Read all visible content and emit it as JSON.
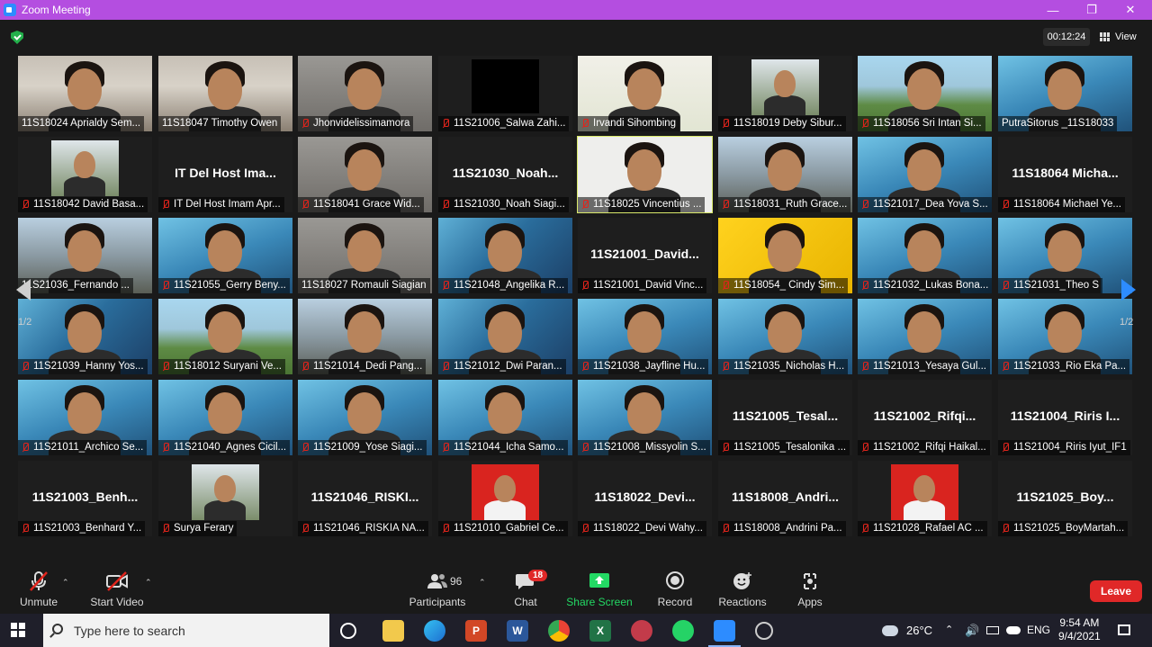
{
  "window": {
    "title": "Zoom Meeting"
  },
  "meeting": {
    "timer": "00:12:24",
    "view_label": "View"
  },
  "pager": {
    "left": "1/2",
    "right": "1/2"
  },
  "tiles": [
    {
      "label": "11S18024 Aprialdy Sem...",
      "muted": false,
      "kind": "video",
      "bg": "v-room"
    },
    {
      "label": "11S18047 Timothy Owen",
      "muted": false,
      "kind": "video",
      "bg": "v-room"
    },
    {
      "label": "Jhonvidelissimamora",
      "muted": true,
      "kind": "video",
      "bg": "v-grey"
    },
    {
      "label": "11S21006_Salwa Zahi...",
      "muted": true,
      "kind": "black",
      "bg": "v-dark"
    },
    {
      "label": "Irvandi Sihombing",
      "muted": true,
      "kind": "video",
      "bg": "v-sign"
    },
    {
      "label": "11S18019 Deby Sibur...",
      "muted": true,
      "kind": "photo",
      "bg": "v-dark"
    },
    {
      "label": "11S18056 Sri Intan Si...",
      "muted": true,
      "kind": "video",
      "bg": "v-grass"
    },
    {
      "label": "PutraSitorus _11S18033",
      "muted": false,
      "kind": "video",
      "bg": "v-bluehouse"
    },
    {
      "label": "11S18042 David Basa...",
      "muted": true,
      "kind": "photo",
      "bg": "v-dark"
    },
    {
      "label": "IT Del Host Imam Apr...",
      "muted": true,
      "kind": "name",
      "name": "IT Del Host Ima...",
      "bg": "v-dark"
    },
    {
      "label": "11S18041 Grace Wid...",
      "muted": true,
      "kind": "video",
      "bg": "v-grey"
    },
    {
      "label": "11S21030_Noah Siagi...",
      "muted": true,
      "kind": "name",
      "name": "11S21030_Noah...",
      "bg": "v-dark"
    },
    {
      "label": "11S18025 Vincentius ...",
      "muted": true,
      "kind": "video",
      "bg": "v-white",
      "speaker": true
    },
    {
      "label": "11S18031_Ruth Grace...",
      "muted": true,
      "kind": "video",
      "bg": "v-stone"
    },
    {
      "label": "11S21017_Dea Yova S...",
      "muted": true,
      "kind": "video",
      "bg": "v-bluehouse"
    },
    {
      "label": "11S18064 Michael Ye...",
      "muted": true,
      "kind": "name",
      "name": "11S18064 Micha...",
      "bg": "v-dark"
    },
    {
      "label": "11S21036_Fernando ...",
      "muted": false,
      "kind": "video",
      "bg": "v-stone"
    },
    {
      "label": "11S21055_Gerry Beny...",
      "muted": true,
      "kind": "video",
      "bg": "v-bluehouse"
    },
    {
      "label": "11S18027 Romauli Siagian",
      "muted": false,
      "kind": "video",
      "bg": "v-grey"
    },
    {
      "label": "11S21048_Angelika R...",
      "muted": true,
      "kind": "video",
      "bg": "v-blue"
    },
    {
      "label": "11S21001_David Vinc...",
      "muted": true,
      "kind": "name",
      "name": "11S21001_David...",
      "bg": "v-dark"
    },
    {
      "label": "11S18054_ Cindy Sim...",
      "muted": true,
      "kind": "video",
      "bg": "v-yellow"
    },
    {
      "label": "11S21032_Lukas Bona...",
      "muted": true,
      "kind": "video",
      "bg": "v-bluehouse"
    },
    {
      "label": "11S21031_Theo S",
      "muted": true,
      "kind": "video",
      "bg": "v-bluehouse"
    },
    {
      "label": "11S21039_Hanny Yos...",
      "muted": true,
      "kind": "video",
      "bg": "v-blue"
    },
    {
      "label": "11S18012 Suryani Ve...",
      "muted": true,
      "kind": "video",
      "bg": "v-grass"
    },
    {
      "label": "11S21014_Dedi Pang...",
      "muted": true,
      "kind": "video",
      "bg": "v-stone"
    },
    {
      "label": "11S21012_Dwi Paran...",
      "muted": true,
      "kind": "video",
      "bg": "v-blue"
    },
    {
      "label": "11S21038_Jayfline Hu...",
      "muted": true,
      "kind": "video",
      "bg": "v-bluehouse"
    },
    {
      "label": "11S21035_Nicholas H...",
      "muted": true,
      "kind": "video",
      "bg": "v-bluehouse"
    },
    {
      "label": "11S21013_Yesaya Gul...",
      "muted": true,
      "kind": "video",
      "bg": "v-bluehouse"
    },
    {
      "label": "11S21033_Rio Eka Pa...",
      "muted": true,
      "kind": "video",
      "bg": "v-bluehouse"
    },
    {
      "label": "11S21011_Archico Se...",
      "muted": true,
      "kind": "video",
      "bg": "v-bluehouse"
    },
    {
      "label": "11S21040_Agnes Cicil...",
      "muted": true,
      "kind": "video",
      "bg": "v-bluehouse"
    },
    {
      "label": "11S21009_Yose Siagi...",
      "muted": true,
      "kind": "video",
      "bg": "v-bluehouse"
    },
    {
      "label": "11S21044_Icha Samo...",
      "muted": true,
      "kind": "video",
      "bg": "v-bluehouse"
    },
    {
      "label": "11S21008_Missyolin S...",
      "muted": true,
      "kind": "video",
      "bg": "v-bluehouse"
    },
    {
      "label": "11S21005_Tesalonika ...",
      "muted": true,
      "kind": "name",
      "name": "11S21005_Tesal...",
      "bg": "v-dark"
    },
    {
      "label": "11S21002_Rifqi Haikal...",
      "muted": true,
      "kind": "name",
      "name": "11S21002_Rifqi...",
      "bg": "v-dark"
    },
    {
      "label": "11S21004_Riris Iyut_IF1",
      "muted": true,
      "kind": "name",
      "name": "11S21004_Riris I...",
      "bg": "v-dark"
    },
    {
      "label": "11S21003_Benhard Y...",
      "muted": true,
      "kind": "name",
      "name": "11S21003_Benh...",
      "bg": "v-dark"
    },
    {
      "label": "Surya Ferary",
      "muted": true,
      "kind": "photo",
      "bg": "v-dark"
    },
    {
      "label": "11S21046_RISKIA NA...",
      "muted": true,
      "kind": "name",
      "name": "11S21046_RISKI...",
      "bg": "v-dark"
    },
    {
      "label": "11S21010_Gabriel Ce...",
      "muted": true,
      "kind": "redphoto",
      "bg": "v-dark"
    },
    {
      "label": "11S18022_Devi Wahy...",
      "muted": true,
      "kind": "name",
      "name": "11S18022_Devi...",
      "bg": "v-dark"
    },
    {
      "label": "11S18008_Andrini Pa...",
      "muted": true,
      "kind": "name",
      "name": "11S18008_Andri...",
      "bg": "v-dark"
    },
    {
      "label": "11S21028_Rafael AC ...",
      "muted": true,
      "kind": "redphoto",
      "bg": "v-dark"
    },
    {
      "label": "11S21025_BoyMartah...",
      "muted": true,
      "kind": "name",
      "name": "11S21025_Boy...",
      "bg": "v-dark"
    }
  ],
  "toolbar": {
    "unmute": "Unmute",
    "start_video": "Start Video",
    "participants": "Participants",
    "participants_count": "96",
    "chat": "Chat",
    "chat_badge": "18",
    "share_screen": "Share Screen",
    "record": "Record",
    "reactions": "Reactions",
    "apps": "Apps",
    "leave": "Leave"
  },
  "taskbar": {
    "search_placeholder": "Type here to search",
    "temperature": "26°C",
    "language": "ENG",
    "time": "9:54 AM",
    "date": "9/4/2021"
  },
  "colors": {
    "accent": "#2d8cff",
    "title_bar": "#b44ee0",
    "leave": "#e02828",
    "share": "#23d964"
  }
}
